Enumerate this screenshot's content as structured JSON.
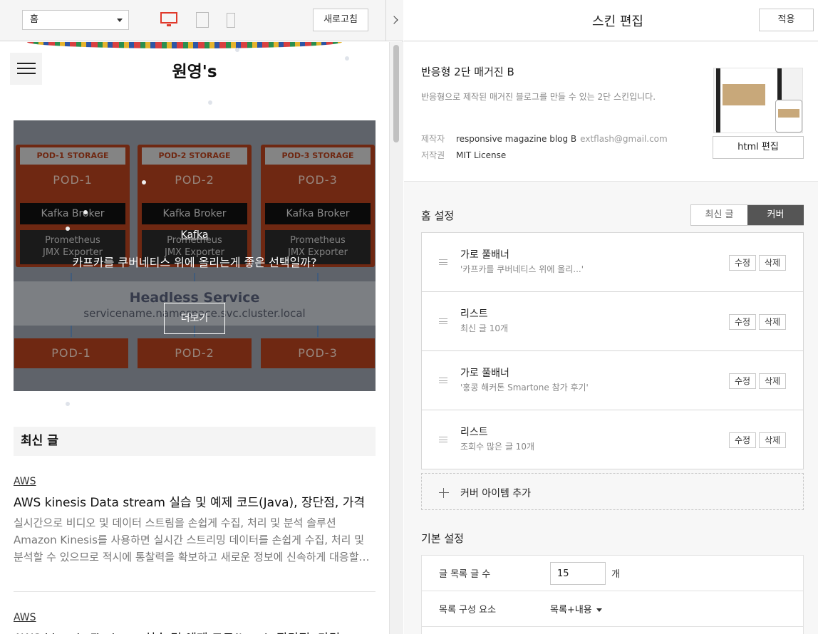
{
  "toolbar": {
    "page_select": "홈",
    "reload": "새로고침"
  },
  "blog": {
    "title": "원영's",
    "hero": {
      "category": "Kafka",
      "title": "카프카를 쿠버네티스 위에 올리는게 좋은 선택일까?",
      "more": "더보기",
      "diagram": {
        "storage": [
          "POD-1 STORAGE",
          "POD-2 STORAGE",
          "POD-3 STORAGE"
        ],
        "pods": [
          "POD-1",
          "POD-2",
          "POD-3"
        ],
        "broker": "Kafka Broker",
        "exporter_1": "Prometheus",
        "exporter_2": "JMX Exporter",
        "service": "Headless Service",
        "service_dns": "servicename.namespace.svc.cluster.local"
      }
    },
    "recent_heading": "최신 글",
    "posts": [
      {
        "category": "AWS",
        "title": "AWS kinesis Data stream 실습 및 예제 코드(Java), 장단점, 가격",
        "excerpt": "실시간으로 비디오 및 데이터 스트림을 손쉽게 수집, 처리 및 분석 솔루션 Amazon Kinesis를 사용하면 실시간 스트리밍 데이터를 손쉽게 수집, 처리 및 분석할 수 있으므로 적시에 통찰력을 확보하고 새로운 정보에 신속하게 대응할…"
      },
      {
        "category": "AWS",
        "title": "AWS kinesis Firehose 실습 및 예제 코드(Java), 장단점, 가격"
      }
    ]
  },
  "editor": {
    "title": "스킨 편집",
    "apply": "적용",
    "skin": {
      "name": "반응형 2단 매거진 B",
      "description": "반응형으로 제작된 매거진 블로그를 만들 수 있는 2단 스킨입니다.",
      "maker_label": "제작자",
      "maker": "responsive magazine blog B",
      "maker_email": "extflash@gmail.com",
      "license_label": "저작권",
      "license": "MIT License",
      "html_edit": "html 편집"
    },
    "home": {
      "label": "홈 설정",
      "toggle": [
        "최신 글",
        "커버"
      ],
      "active": "커버"
    },
    "cover_items": [
      {
        "title": "가로 풀배너",
        "sub": "'카프카를 쿠버네티스 위에 올리...'"
      },
      {
        "title": "리스트",
        "sub": "최신 글 10개"
      },
      {
        "title": "가로 풀배너",
        "sub": "'홍콩 해커톤 Smartone 참가 후기'"
      },
      {
        "title": "리스트",
        "sub": "조회수 많은 글 10개"
      }
    ],
    "cover_edit": "수정",
    "cover_delete": "삭제",
    "add_cover": "커버 아이템 추가",
    "basic": {
      "label": "기본 설정",
      "post_count_label": "글 목록 글 수",
      "post_count": "15",
      "post_count_unit": "개",
      "composition_label": "목록 구성 요소",
      "composition_value": "목록+내용"
    }
  },
  "colors": {
    "accent_device": "#e0392b",
    "toggle_active": "#555555"
  },
  "icons": [
    "hamburger-icon",
    "desktop-icon",
    "tablet-icon",
    "mobile-icon",
    "chevron-right-icon",
    "drag-handle-icon",
    "plus-icon",
    "caret-down-icon"
  ]
}
